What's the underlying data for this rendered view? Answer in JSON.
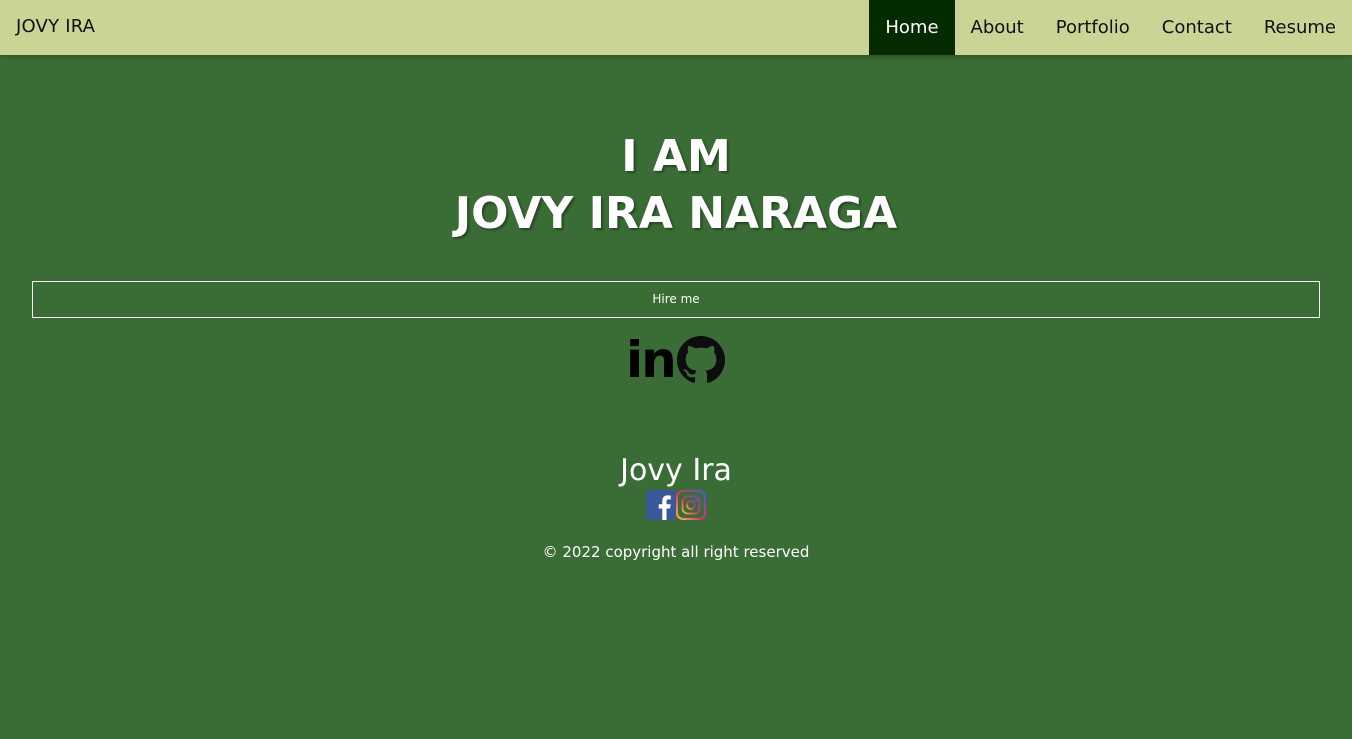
{
  "nav": {
    "brand": "JOVY IRA",
    "links": [
      {
        "label": "Home",
        "active": true
      },
      {
        "label": "About",
        "active": false
      },
      {
        "label": "Portfolio",
        "active": false
      },
      {
        "label": "Contact",
        "active": false
      },
      {
        "label": "Resume",
        "active": false
      }
    ]
  },
  "hero": {
    "line1": "I AM",
    "line2": "JOVY IRA NARAGA",
    "hire_label": "Hire me"
  },
  "social": {
    "linkedin_glyph": "in",
    "icons": [
      "linkedin-icon",
      "github-icon"
    ]
  },
  "footer": {
    "name": "Jovy Ira",
    "icons": [
      "facebook-icon",
      "instagram-icon"
    ],
    "copyright": "© 2022 copyright all right reserved"
  },
  "colors": {
    "background": "#3a6d35",
    "navbar": "#cbd395",
    "active_nav": "#042a00",
    "text_light": "#ffffff",
    "facebook_blue": "#3b5998"
  }
}
